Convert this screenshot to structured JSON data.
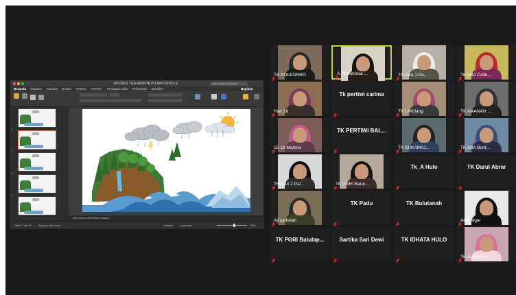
{
  "powerpoint": {
    "doc_title": "PROSES TERJADINYA HUJAN DOODLE",
    "search_placeholder": "Cari dalam dokumen",
    "ribbon_tabs": [
      "Beranda",
      "Sisipkan",
      "Gambar",
      "Desain",
      "Transisi",
      "Animasi",
      "Peragaan Slide",
      "Peninjauan",
      "Tampilan"
    ],
    "share_label": "Bagikan",
    "slide_numbers": [
      "6",
      "7",
      "8",
      "9",
      "10",
      "11"
    ],
    "notes_placeholder": "Klik untuk menambah catatan",
    "status_left": "Slide 7 dari 30",
    "status_lang": "Bahasa Indonesia",
    "status_notes": "Catatan",
    "status_comments": "Komentar",
    "zoom": "70%"
  },
  "participants": [
    {
      "name": "TK POLEONRO",
      "video": true
    },
    {
      "name": "A. Nurannisa ...",
      "video": true,
      "active": true
    },
    {
      "name": "TK ABA 1 Pa...",
      "video": true
    },
    {
      "name": "TK ABA CABL...",
      "video": true
    },
    {
      "name": "Hari 18",
      "video": true
    },
    {
      "name": "Tk pertiwi carima",
      "video": false
    },
    {
      "name": "TK LANJang",
      "video": true
    },
    {
      "name": "TK AMANAH ...",
      "video": true
    },
    {
      "name": "15-18 Marlina",
      "video": true
    },
    {
      "name": "TK PERTIWI BAL...",
      "video": false
    },
    {
      "name": "TK SUKAMAJ...",
      "video": true
    },
    {
      "name": "TK ABA Bont...",
      "video": true
    },
    {
      "name": "TK ABA 2 Pal...",
      "video": true
    },
    {
      "name": "TK PGRI Batul...",
      "video": true
    },
    {
      "name": "Tk_A Hulo",
      "video": false
    },
    {
      "name": "TK Darul Abrar",
      "video": false
    },
    {
      "name": "Aji saifullah",
      "video": true
    },
    {
      "name": "TK Padu",
      "video": false
    },
    {
      "name": "TK Bulutanah",
      "video": false
    },
    {
      "name": "Andi Aigar",
      "video": true
    },
    {
      "name": "TK PGRI Batulap...",
      "video": false
    },
    {
      "name": "Sartika Sari Dewi",
      "video": false
    },
    {
      "name": "TK IDHATA HULO",
      "video": false
    },
    {
      "name": "TK Asqiyah B...",
      "video": true
    }
  ]
}
